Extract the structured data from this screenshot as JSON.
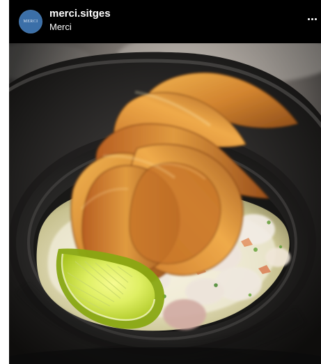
{
  "post": {
    "username": "merci.sitges",
    "subtitle": "Merci",
    "avatar_text": "MERCI",
    "more_icon": "more-horizontal-icon"
  },
  "photo": {
    "icon": "food-photo",
    "colors": {
      "header": "#000000",
      "plate": "#2d2b2a",
      "chips": "#d2842f",
      "lime": "#a8c91f"
    }
  }
}
